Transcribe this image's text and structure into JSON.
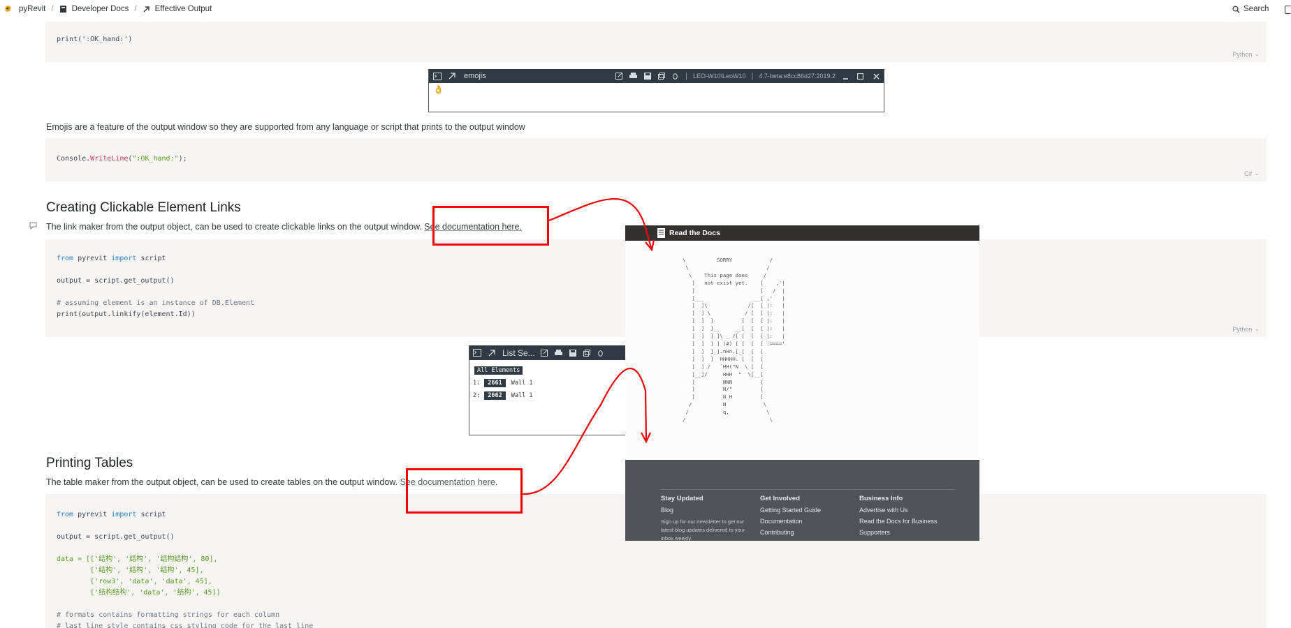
{
  "nav": {
    "brand": "pyRevit",
    "crumb2": "Developer Docs",
    "crumb3": "Effective Output",
    "search": "Search"
  },
  "code1": {
    "line": "print(':OK_hand:')",
    "lang": "Python"
  },
  "emoji_window": {
    "title": "emojis",
    "user": "LEO-W10\\LeoW10",
    "version": "4.7-beta:e8cc86d27:2019.2",
    "emoji": "👌"
  },
  "para_emoji": "Emojis are a feature of the output window so they are supported from any language or script that prints to the output window",
  "code2": {
    "obj": "Console.",
    "method": "WriteLine",
    "arg": "\":OK_hand:\"",
    "tail": ");",
    "lang": "C#"
  },
  "section1": {
    "heading": "Creating Clickable Element Links",
    "text": "The link maker from the output object, can be used to create clickable links on the output window.",
    "link": "See documentation here."
  },
  "code3": {
    "lang": "Python",
    "l1a": "from",
    "l1b": " pyrevit ",
    "l1c": "import",
    "l1d": " script",
    "l2": "output = script.get_output()",
    "l3": "# assuming element is an instance of DB.Element",
    "l4": "print(output.linkify(element.Id))"
  },
  "list_window": {
    "title": "List Se...",
    "header": "All Elements",
    "rows": [
      {
        "idx": "1:",
        "id": "2661",
        "name": "Wall 1"
      },
      {
        "idx": "2:",
        "id": "2662",
        "name": "Wall 1"
      }
    ]
  },
  "section2": {
    "heading": "Printing Tables",
    "text": "The table maker from the output object, can be used to create tables on the output window.",
    "link": "See documentation here."
  },
  "code4": {
    "l1a": "from",
    "l1b": " pyrevit ",
    "l1c": "import",
    "l1d": " script",
    "l2": "output = script.get_output()",
    "d1": "data = [['结构', '结构', '结构结构', 80],",
    "d2": "        ['结构', '结构', '结构', 45],",
    "d3": "        ['row3', 'data', 'data', 45],",
    "d4": "        ['结构结构', 'data', '结构', 45]]",
    "c1": "# formats contains formatting strings for each column",
    "c2": "# last_line_style contains css styling code for the last line"
  },
  "rtd": {
    "brand": "Read the Docs",
    "ascii": "\\          SORRY            /\n \\                         /\n  \\    This page does     /\n   ]   not exist yet.    [    ,'|\n   ]                     [   /  |\n   ]___               ___[ ,'   |\n   ]  ]\\             /[  [ |:   |\n   ]  ] \\           / [  [ |:   |\n   ]  ]  ]         [  [  [ |:   |\n   ]  ]  ]__     __[  [  [ |:   |\n   ]  ]  ] ]\\ _ /[ [  [  [ |:   |\n   ]  ]  ] ] (#) [ [  [  [ :===='\n   ]  ]  ]_].nHn.[_[  [  [\n   ]  ]  ]  HHHHH. [  [  [\n   ]  ] /   `HH(\"N  \\ [  [\n   ]__]/     HHH  \"  \\[__[\n   ]         NNN         [\n   ]         N/\"         [\n   ]         N H         [\n  /          N            \\\n /           q,            \\\n/                           \\",
    "col1": {
      "h": "Stay Updated",
      "i1": "Blog",
      "s": "Sign up for our newsletter to get our latest blog updates delivered to your inbox weekly."
    },
    "col2": {
      "h": "Get Involved",
      "i1": "Getting Started Guide",
      "i2": "Documentation",
      "i3": "Contributing"
    },
    "col3": {
      "h": "Business Info",
      "i1": "Advertise with Us",
      "i2": "Read the Docs for Business",
      "i3": "Supporters"
    }
  },
  "colors": {
    "annotation": "#ee0000",
    "window_bar": "#2f3a45",
    "code_bg": "#f6f5f3"
  }
}
